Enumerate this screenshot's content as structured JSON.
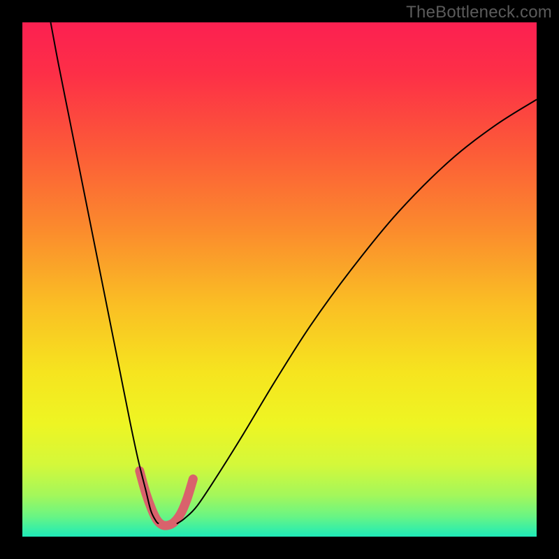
{
  "watermark": "TheBottleneck.com",
  "chart_data": {
    "type": "line",
    "title": "",
    "xlabel": "",
    "ylabel": "",
    "xlim": [
      0,
      1
    ],
    "ylim": [
      0,
      1
    ],
    "gradient_stops": [
      {
        "offset": 0.0,
        "color": "#fc2051"
      },
      {
        "offset": 0.1,
        "color": "#fd2f47"
      },
      {
        "offset": 0.25,
        "color": "#fc5b38"
      },
      {
        "offset": 0.4,
        "color": "#fb8a2d"
      },
      {
        "offset": 0.55,
        "color": "#fabf24"
      },
      {
        "offset": 0.68,
        "color": "#f6e41f"
      },
      {
        "offset": 0.78,
        "color": "#eef523"
      },
      {
        "offset": 0.86,
        "color": "#d4f83a"
      },
      {
        "offset": 0.92,
        "color": "#a3f75b"
      },
      {
        "offset": 0.96,
        "color": "#6af583"
      },
      {
        "offset": 0.985,
        "color": "#39efa5"
      },
      {
        "offset": 1.0,
        "color": "#1fe9b8"
      }
    ],
    "series": [
      {
        "name": "left-limb",
        "stroke": "#000000",
        "stroke_width": 2,
        "x": [
          0.055,
          0.07,
          0.09,
          0.11,
          0.13,
          0.15,
          0.17,
          0.19,
          0.21,
          0.225,
          0.24,
          0.25,
          0.26,
          0.265
        ],
        "y": [
          1.0,
          0.92,
          0.82,
          0.72,
          0.62,
          0.52,
          0.42,
          0.32,
          0.22,
          0.15,
          0.09,
          0.05,
          0.03,
          0.025
        ]
      },
      {
        "name": "right-limb",
        "stroke": "#000000",
        "stroke_width": 2,
        "x": [
          0.3,
          0.315,
          0.34,
          0.38,
          0.43,
          0.49,
          0.56,
          0.64,
          0.73,
          0.83,
          0.92,
          1.0
        ],
        "y": [
          0.025,
          0.035,
          0.06,
          0.12,
          0.2,
          0.3,
          0.41,
          0.52,
          0.63,
          0.73,
          0.8,
          0.85
        ]
      },
      {
        "name": "valley-highlight",
        "stroke": "#d9626c",
        "stroke_width": 13,
        "linecap": "round",
        "x": [
          0.228,
          0.24,
          0.252,
          0.262,
          0.272,
          0.283,
          0.295,
          0.308,
          0.32,
          0.332
        ],
        "y": [
          0.128,
          0.085,
          0.052,
          0.032,
          0.023,
          0.022,
          0.028,
          0.045,
          0.073,
          0.112
        ]
      }
    ],
    "valley_min_x": 0.278
  }
}
